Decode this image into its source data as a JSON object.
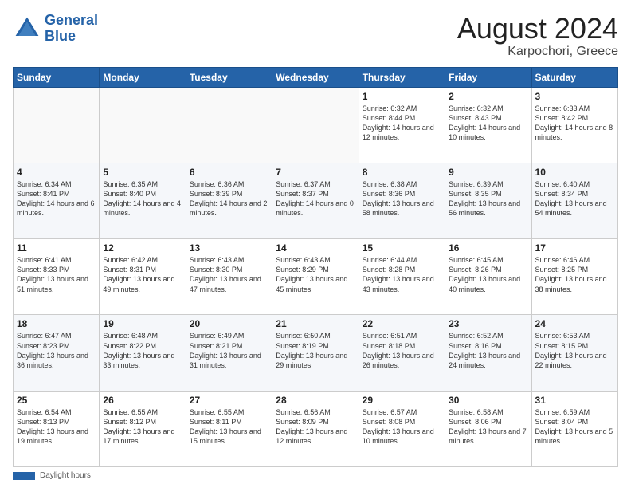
{
  "header": {
    "logo_line1": "General",
    "logo_line2": "Blue",
    "main_title": "August 2024",
    "subtitle": "Karpochori, Greece"
  },
  "legend": {
    "label": "Daylight hours"
  },
  "days_of_week": [
    "Sunday",
    "Monday",
    "Tuesday",
    "Wednesday",
    "Thursday",
    "Friday",
    "Saturday"
  ],
  "weeks": [
    [
      {
        "num": "",
        "info": ""
      },
      {
        "num": "",
        "info": ""
      },
      {
        "num": "",
        "info": ""
      },
      {
        "num": "",
        "info": ""
      },
      {
        "num": "1",
        "info": "Sunrise: 6:32 AM\nSunset: 8:44 PM\nDaylight: 14 hours\nand 12 minutes."
      },
      {
        "num": "2",
        "info": "Sunrise: 6:32 AM\nSunset: 8:43 PM\nDaylight: 14 hours\nand 10 minutes."
      },
      {
        "num": "3",
        "info": "Sunrise: 6:33 AM\nSunset: 8:42 PM\nDaylight: 14 hours\nand 8 minutes."
      }
    ],
    [
      {
        "num": "4",
        "info": "Sunrise: 6:34 AM\nSunset: 8:41 PM\nDaylight: 14 hours\nand 6 minutes."
      },
      {
        "num": "5",
        "info": "Sunrise: 6:35 AM\nSunset: 8:40 PM\nDaylight: 14 hours\nand 4 minutes."
      },
      {
        "num": "6",
        "info": "Sunrise: 6:36 AM\nSunset: 8:39 PM\nDaylight: 14 hours\nand 2 minutes."
      },
      {
        "num": "7",
        "info": "Sunrise: 6:37 AM\nSunset: 8:37 PM\nDaylight: 14 hours\nand 0 minutes."
      },
      {
        "num": "8",
        "info": "Sunrise: 6:38 AM\nSunset: 8:36 PM\nDaylight: 13 hours\nand 58 minutes."
      },
      {
        "num": "9",
        "info": "Sunrise: 6:39 AM\nSunset: 8:35 PM\nDaylight: 13 hours\nand 56 minutes."
      },
      {
        "num": "10",
        "info": "Sunrise: 6:40 AM\nSunset: 8:34 PM\nDaylight: 13 hours\nand 54 minutes."
      }
    ],
    [
      {
        "num": "11",
        "info": "Sunrise: 6:41 AM\nSunset: 8:33 PM\nDaylight: 13 hours\nand 51 minutes."
      },
      {
        "num": "12",
        "info": "Sunrise: 6:42 AM\nSunset: 8:31 PM\nDaylight: 13 hours\nand 49 minutes."
      },
      {
        "num": "13",
        "info": "Sunrise: 6:43 AM\nSunset: 8:30 PM\nDaylight: 13 hours\nand 47 minutes."
      },
      {
        "num": "14",
        "info": "Sunrise: 6:43 AM\nSunset: 8:29 PM\nDaylight: 13 hours\nand 45 minutes."
      },
      {
        "num": "15",
        "info": "Sunrise: 6:44 AM\nSunset: 8:28 PM\nDaylight: 13 hours\nand 43 minutes."
      },
      {
        "num": "16",
        "info": "Sunrise: 6:45 AM\nSunset: 8:26 PM\nDaylight: 13 hours\nand 40 minutes."
      },
      {
        "num": "17",
        "info": "Sunrise: 6:46 AM\nSunset: 8:25 PM\nDaylight: 13 hours\nand 38 minutes."
      }
    ],
    [
      {
        "num": "18",
        "info": "Sunrise: 6:47 AM\nSunset: 8:23 PM\nDaylight: 13 hours\nand 36 minutes."
      },
      {
        "num": "19",
        "info": "Sunrise: 6:48 AM\nSunset: 8:22 PM\nDaylight: 13 hours\nand 33 minutes."
      },
      {
        "num": "20",
        "info": "Sunrise: 6:49 AM\nSunset: 8:21 PM\nDaylight: 13 hours\nand 31 minutes."
      },
      {
        "num": "21",
        "info": "Sunrise: 6:50 AM\nSunset: 8:19 PM\nDaylight: 13 hours\nand 29 minutes."
      },
      {
        "num": "22",
        "info": "Sunrise: 6:51 AM\nSunset: 8:18 PM\nDaylight: 13 hours\nand 26 minutes."
      },
      {
        "num": "23",
        "info": "Sunrise: 6:52 AM\nSunset: 8:16 PM\nDaylight: 13 hours\nand 24 minutes."
      },
      {
        "num": "24",
        "info": "Sunrise: 6:53 AM\nSunset: 8:15 PM\nDaylight: 13 hours\nand 22 minutes."
      }
    ],
    [
      {
        "num": "25",
        "info": "Sunrise: 6:54 AM\nSunset: 8:13 PM\nDaylight: 13 hours\nand 19 minutes."
      },
      {
        "num": "26",
        "info": "Sunrise: 6:55 AM\nSunset: 8:12 PM\nDaylight: 13 hours\nand 17 minutes."
      },
      {
        "num": "27",
        "info": "Sunrise: 6:55 AM\nSunset: 8:11 PM\nDaylight: 13 hours\nand 15 minutes."
      },
      {
        "num": "28",
        "info": "Sunrise: 6:56 AM\nSunset: 8:09 PM\nDaylight: 13 hours\nand 12 minutes."
      },
      {
        "num": "29",
        "info": "Sunrise: 6:57 AM\nSunset: 8:08 PM\nDaylight: 13 hours\nand 10 minutes."
      },
      {
        "num": "30",
        "info": "Sunrise: 6:58 AM\nSunset: 8:06 PM\nDaylight: 13 hours\nand 7 minutes."
      },
      {
        "num": "31",
        "info": "Sunrise: 6:59 AM\nSunset: 8:04 PM\nDaylight: 13 hours\nand 5 minutes."
      }
    ]
  ]
}
